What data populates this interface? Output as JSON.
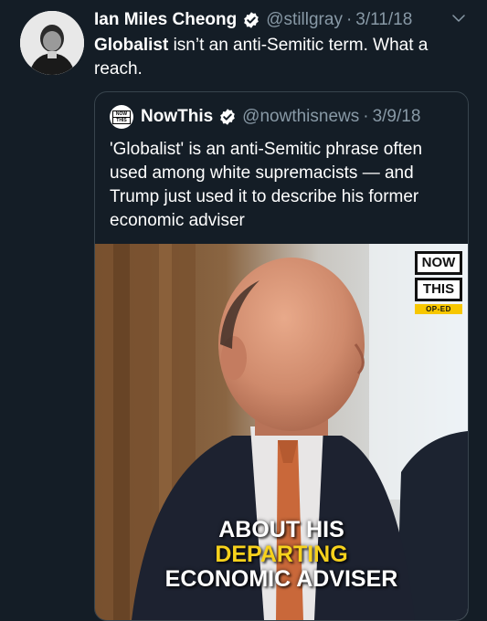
{
  "tweet": {
    "author_name": "Ian Miles Cheong",
    "handle": "@stillgray",
    "separator": "·",
    "date": "3/11/18",
    "text_bold": "Globalist",
    "text_rest": " isn’t an anti-Semitic term. What a reach.",
    "verified_icon": "verified-badge-icon",
    "menu_icon": "chevron-down-icon"
  },
  "quoted": {
    "author_name": "NowThis",
    "handle": "@nowthisnews",
    "separator": "·",
    "date": "3/9/18",
    "avatar_text_top": "NOW",
    "avatar_text_bottom": "THIS",
    "text": "'Globalist' is an anti-Semitic phrase often used among white supremacists — and Trump just used it to describe his former economic adviser",
    "media": {
      "logo_line1": "NOW",
      "logo_line2": "THIS",
      "logo_tag": "OP-ED",
      "caption_line1": "ABOUT HIS",
      "caption_line2": "DEPARTING",
      "caption_line3": "ECONOMIC ADVISER"
    }
  },
  "colors": {
    "background": "#141d26",
    "secondary_text": "#8899a6",
    "verified_blue": "#ffffff",
    "caption_yellow": "#f7d21c",
    "border": "#38444d"
  }
}
